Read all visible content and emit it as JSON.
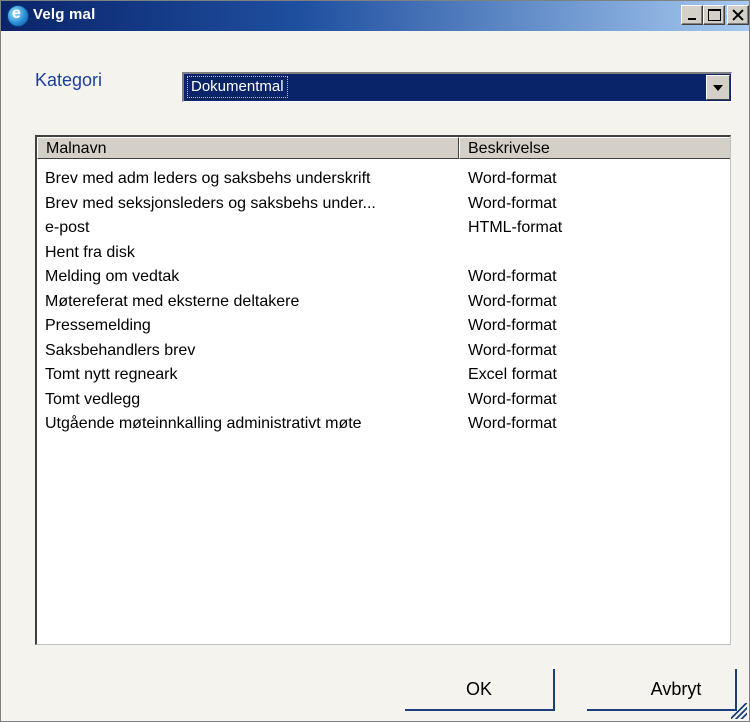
{
  "window": {
    "title": "Velg mal"
  },
  "category": {
    "label": "Kategori",
    "selected": "Dokumentmal"
  },
  "table": {
    "columns": [
      "Malnavn",
      "Beskrivelse"
    ],
    "rows": [
      {
        "name": "Brev med adm leders og saksbehs underskrift",
        "desc": "Word-format"
      },
      {
        "name": "Brev med seksjonsleders og saksbehs under...",
        "desc": "Word-format"
      },
      {
        "name": "e-post",
        "desc": "HTML-format"
      },
      {
        "name": "Hent fra disk",
        "desc": ""
      },
      {
        "name": "Melding om vedtak",
        "desc": "Word-format"
      },
      {
        "name": "Møtereferat med eksterne deltakere",
        "desc": "Word-format"
      },
      {
        "name": "Pressemelding",
        "desc": "Word-format"
      },
      {
        "name": "Saksbehandlers brev",
        "desc": "Word-format"
      },
      {
        "name": "Tomt nytt regneark",
        "desc": "Excel format"
      },
      {
        "name": "Tomt vedlegg",
        "desc": "Word-format"
      },
      {
        "name": "Utgående møteinnkalling administrativt møte",
        "desc": "Word-format"
      }
    ]
  },
  "buttons": {
    "ok": "OK",
    "cancel": "Avbryt"
  }
}
